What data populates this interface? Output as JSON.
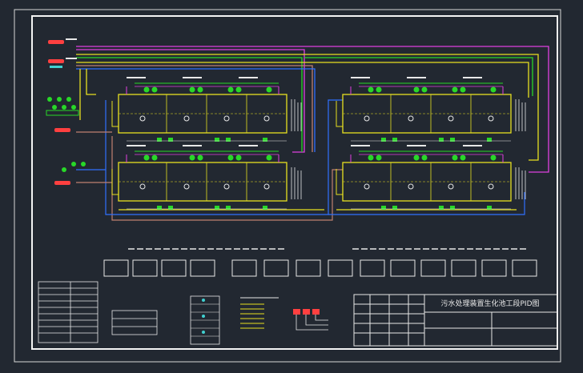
{
  "drawing": {
    "title": "污水处理装置生化池工段PID图"
  },
  "colors": {
    "background": "#222831",
    "frame": "#f2f2f2",
    "magenta": "#e040e0",
    "yellow": "#e8e020",
    "green": "#28d828",
    "blue": "#3070ff",
    "brown": "#c08070",
    "red": "#ff4040",
    "white": "#e8e8e8",
    "cyan": "#40d0d0"
  },
  "layout_counts": {
    "tank_units": 4,
    "legend_boxes": 14
  }
}
